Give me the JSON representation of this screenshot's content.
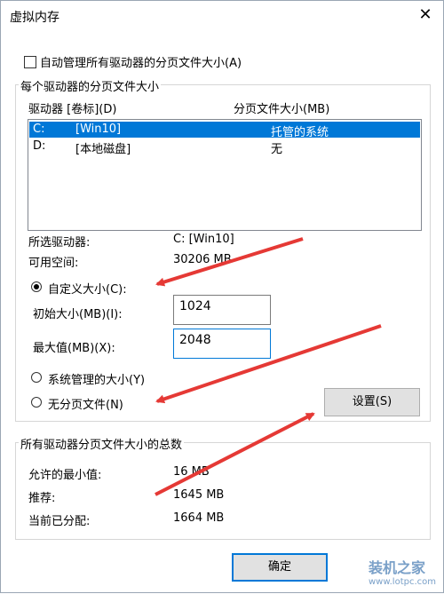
{
  "window": {
    "title": "虚拟内存",
    "close_glyph": "✕"
  },
  "auto_manage": {
    "label": "自动管理所有驱动器的分页文件大小(A)",
    "checked": false
  },
  "per_drive": {
    "group_title": "每个驱动器的分页文件大小",
    "col_drive": "驱动器 [卷标](D)",
    "col_size": "分页文件大小(MB)",
    "rows": [
      {
        "drive": "C:",
        "label": "[Win10]",
        "size": "托管的系统",
        "selected": true
      },
      {
        "drive": "D:",
        "label": "[本地磁盘]",
        "size": "无",
        "selected": false
      }
    ],
    "selected_drive_label": "所选驱动器:",
    "selected_drive_value": "C:  [Win10]",
    "free_space_label": "可用空间:",
    "free_space_value": "30206 MB",
    "custom_label": "自定义大小(C):",
    "initial_label": "初始大小(MB)(I):",
    "initial_value": "1024",
    "max_label": "最大值(MB)(X):",
    "max_value": "2048",
    "system_label": "系统管理的大小(Y)",
    "none_label": "无分页文件(N)",
    "set_button": "设置(S)"
  },
  "totals": {
    "group_title": "所有驱动器分页文件大小的总数",
    "min_label": "允许的最小值:",
    "min_value": "16 MB",
    "recommended_label": "推荐:",
    "recommended_value": "1645 MB",
    "current_label": "当前已分配:",
    "current_value": "1664 MB"
  },
  "footer": {
    "ok_button": "确定"
  },
  "watermark": {
    "text": "装机之家",
    "url": "www.lotpc.com"
  },
  "colors": {
    "selection": "#0078d7",
    "arrow": "#e53935"
  }
}
